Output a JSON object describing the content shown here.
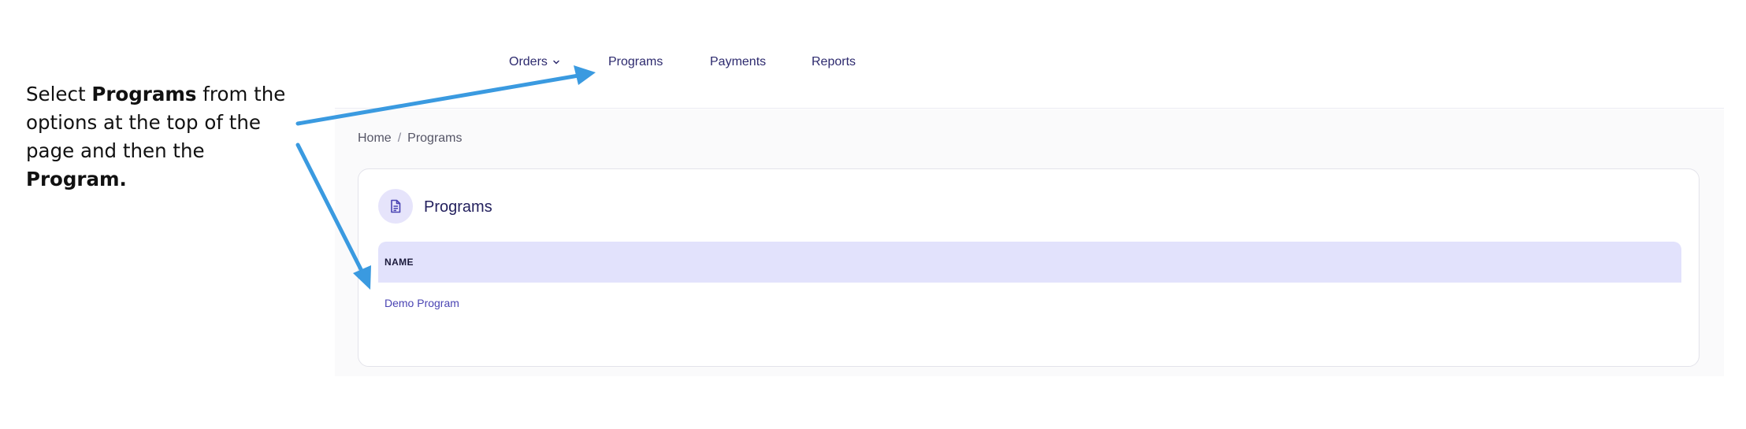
{
  "instruction": {
    "part1": "Select ",
    "bold1": "Programs",
    "part2": " from the options at the top of the page and then the ",
    "bold2": "Program."
  },
  "nav": {
    "items": [
      {
        "label": "Orders"
      },
      {
        "label": "Programs"
      },
      {
        "label": "Payments"
      },
      {
        "label": "Reports"
      }
    ]
  },
  "breadcrumb": {
    "home": "Home",
    "separator": "/",
    "current": "Programs"
  },
  "card": {
    "title": "Programs",
    "icon": "document-icon"
  },
  "table": {
    "columns": [
      "NAME"
    ],
    "rows": [
      [
        "Demo Program"
      ]
    ]
  },
  "colors": {
    "accent": "#4a44b3",
    "arrow": "#3a9ae0",
    "header_bg": "#e2e2fc"
  }
}
